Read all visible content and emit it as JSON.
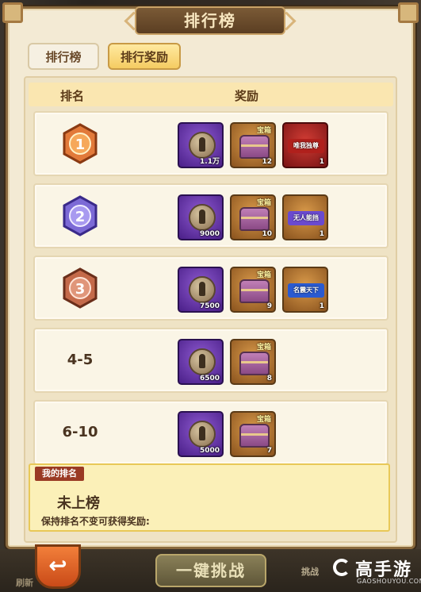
{
  "title": "排行榜",
  "tabs": [
    {
      "label": "排行榜",
      "active": false
    },
    {
      "label": "排行奖励",
      "active": true
    }
  ],
  "table_header": {
    "rank": "排名",
    "reward": "奖励"
  },
  "rows": [
    {
      "rank": "1",
      "rewards": [
        {
          "type": "token",
          "count": "1.1万",
          "color": "purple"
        },
        {
          "type": "chest",
          "label": "宝箱",
          "count": "12",
          "color": "gold"
        },
        {
          "type": "title",
          "label": "唯我独尊",
          "count": "1",
          "color": "red"
        }
      ]
    },
    {
      "rank": "2",
      "rewards": [
        {
          "type": "token",
          "count": "9000",
          "color": "purple"
        },
        {
          "type": "chest",
          "label": "宝箱",
          "count": "10",
          "color": "gold"
        },
        {
          "type": "title",
          "label": "无人能挡",
          "count": "1",
          "color": "gold"
        }
      ]
    },
    {
      "rank": "3",
      "rewards": [
        {
          "type": "token",
          "count": "7500",
          "color": "purple"
        },
        {
          "type": "chest",
          "label": "宝箱",
          "count": "9",
          "color": "gold"
        },
        {
          "type": "title",
          "label": "名震天下",
          "count": "1",
          "color": "gold"
        }
      ]
    },
    {
      "rank": "4-5",
      "rewards": [
        {
          "type": "token",
          "count": "6500",
          "color": "purple"
        },
        {
          "type": "chest",
          "label": "宝箱",
          "count": "8",
          "color": "gold"
        }
      ]
    },
    {
      "rank": "6-10",
      "rewards": [
        {
          "type": "token",
          "count": "5000",
          "color": "purple"
        },
        {
          "type": "chest",
          "label": "宝箱",
          "count": "7",
          "color": "gold"
        }
      ]
    }
  ],
  "my_rank": {
    "label": "我的排名",
    "value": "未上榜",
    "tip": "保持排名不变可获得奖励:"
  },
  "bottom": {
    "back_icon": "back-arrow-icon",
    "refresh": "刷新",
    "one_key": "一键挑战",
    "side": "挑战"
  },
  "watermark": {
    "text": "高手游",
    "url": "GAOSHOUYOU.COM"
  },
  "medal_colors": {
    "1": "#e27a3a",
    "2": "#7c6ad6",
    "3": "#c46a4a"
  }
}
